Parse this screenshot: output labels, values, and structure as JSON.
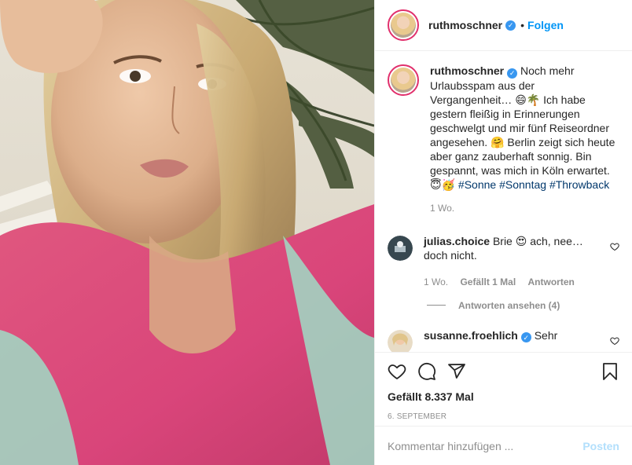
{
  "header": {
    "username": "ruthmoschner",
    "separator": "•",
    "follow_label": "Folgen"
  },
  "caption": {
    "username": "ruthmoschner",
    "text": "Noch mehr Urlaubsspam aus der Vergangenheit… 😄🌴 Ich habe gestern fleißig in Erinnerungen geschwelgt und mir fünf Reiseordner angesehen. 🤗 Berlin zeigt sich heute aber ganz zauberhaft sonnig. Bin gespannt, was mich in Köln erwartet. 😇🥳",
    "hashtags": [
      "#Sonne",
      "#Sonntag",
      "#Throwback"
    ],
    "age": "1 Wo."
  },
  "comments": [
    {
      "username": "julias.choice",
      "text": "Brie 😍 ach, nee… doch nicht.",
      "age": "1 Wo.",
      "likes": "Gefällt 1 Mal",
      "reply_label": "Antworten",
      "view_replies": "Antworten ansehen (4)"
    },
    {
      "username": "susanne.froehlich",
      "text": "Sehr"
    }
  ],
  "actions": {
    "icons": [
      "heart-icon",
      "comment-icon",
      "share-icon",
      "bookmark-icon"
    ],
    "likes": "Gefällt 8.337 Mal",
    "date": "6. SEPTEMBER"
  },
  "add_comment": {
    "placeholder": "Kommentar hinzufügen ...",
    "post_label": "Posten"
  },
  "colors": {
    "link": "#0095f6",
    "hashtag": "#00376b",
    "verified": "#3897f0",
    "muted": "#8e8e8e",
    "post_disabled": "#b2dffc"
  }
}
